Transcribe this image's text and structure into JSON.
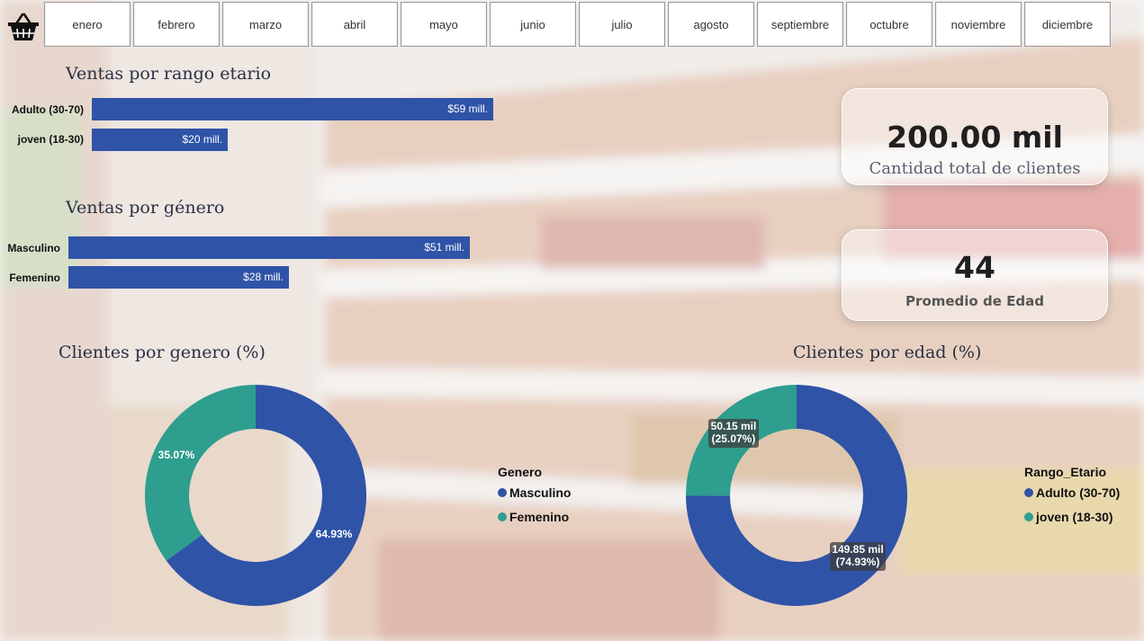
{
  "months": [
    "enero",
    "febrero",
    "marzo",
    "abril",
    "mayo",
    "junio",
    "julio",
    "agosto",
    "septiembre",
    "octubre",
    "noviembre",
    "diciembre"
  ],
  "colors": {
    "blue": "#2f53a7",
    "teal": "#2e9e8f"
  },
  "kpis": {
    "total_clients": {
      "value": "200.00 mil",
      "label": "Cantidad total de clientes"
    },
    "avg_age": {
      "value": "44",
      "label": "Promedio de Edad"
    }
  },
  "chart_data": [
    {
      "type": "bar",
      "orientation": "horizontal",
      "title": "Ventas por rango etario",
      "categories": [
        "Adulto (30-70)",
        "joven (18-30)"
      ],
      "values": [
        59,
        20
      ],
      "value_labels": [
        "$59 mill.",
        "$20 mill."
      ]
    },
    {
      "type": "bar",
      "orientation": "horizontal",
      "title": "Ventas por género",
      "categories": [
        "Masculino",
        "Femenino"
      ],
      "values": [
        51,
        28
      ],
      "value_labels": [
        "$51 mill.",
        "$28 mill."
      ]
    },
    {
      "type": "pie",
      "donut": true,
      "title": "Clientes por genero (%)",
      "legend_title": "Genero",
      "categories": [
        "Masculino",
        "Femenino"
      ],
      "values": [
        64.93,
        35.07
      ],
      "value_labels": [
        "64.93%",
        "35.07%"
      ]
    },
    {
      "type": "pie",
      "donut": true,
      "title": "Clientes por edad (%)",
      "legend_title": "Rango_Etario",
      "categories": [
        "Adulto (30-70)",
        "joven (18-30)"
      ],
      "values": [
        74.93,
        25.07
      ],
      "value_labels": [
        "149.85 mil (74.93%)",
        "50.15 mil (25.07%)"
      ],
      "label_lines": [
        [
          "149.85 mil",
          "(74.93%)"
        ],
        [
          "50.15 mil",
          "(25.07%)"
        ]
      ]
    }
  ]
}
